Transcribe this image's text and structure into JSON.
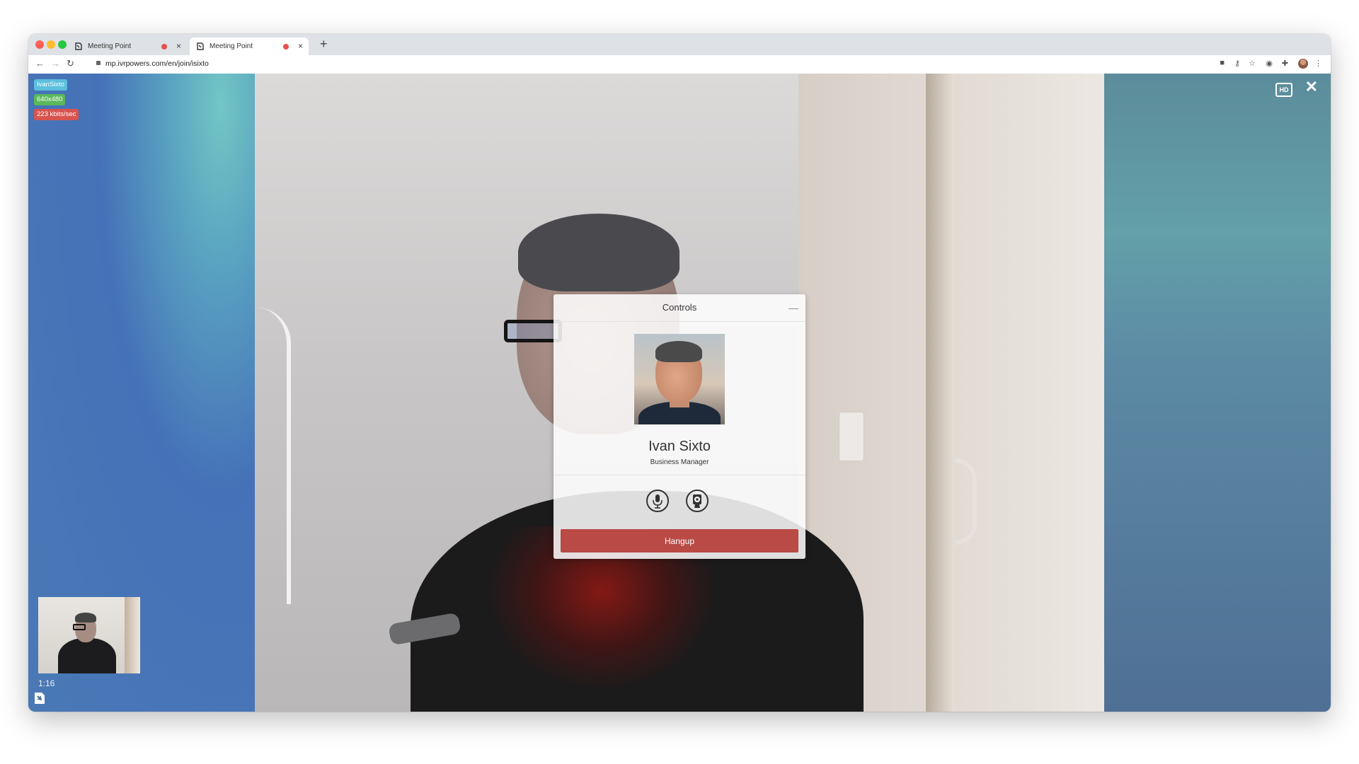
{
  "browser": {
    "tabs": [
      {
        "title": "Meeting Point",
        "active": false
      },
      {
        "title": "Meeting Point",
        "active": true
      }
    ],
    "new_tab_label": "+",
    "tab_close_label": "×",
    "url": "mp.ivrpowers.com/en/join/isixto"
  },
  "call": {
    "badges": {
      "username": "IvanSixto",
      "resolution": "640x480",
      "bitrate": "223 kbits/sec"
    },
    "badge_colors": {
      "username": "#5bc0de",
      "resolution": "#5cb85c",
      "bitrate": "#d9534f"
    },
    "timer": "1:16",
    "hd_label": "HD",
    "close_label": "✕"
  },
  "controls_panel": {
    "title": "Controls",
    "minimize_label": "—",
    "name": "Ivan Sixto",
    "role": "Business Manager",
    "mic_icon": "microphone-icon",
    "camera_icon": "webcam-icon",
    "hangup_label": "Hangup",
    "hangup_color": "#b94a45"
  }
}
